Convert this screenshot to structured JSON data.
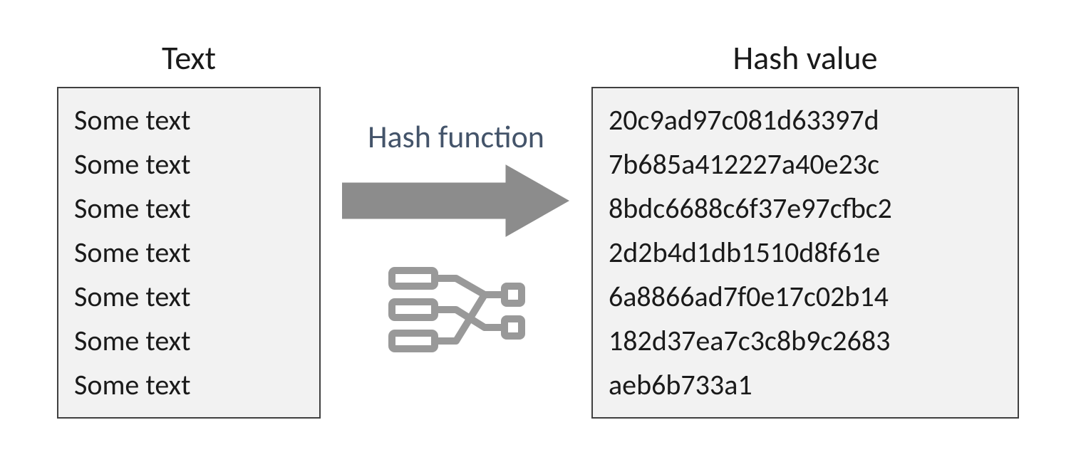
{
  "left": {
    "heading": "Text",
    "lines": [
      "Some text",
      "Some text",
      "Some text",
      "Some text",
      "Some text",
      "Some text",
      "Some text"
    ]
  },
  "middle": {
    "label": "Hash function"
  },
  "right": {
    "heading": "Hash value",
    "lines": [
      "20c9ad97c081d63397d",
      "7b685a412227a40e23c",
      "8bdc6688c6f37e97cfbc2",
      "2d2b4d1db1510d8f61e",
      "6a8866ad7f0e17c02b14",
      "182d37ea7c3c8b9c2683",
      "aeb6b733a1"
    ]
  },
  "colors": {
    "box_border": "#404040",
    "box_bg": "#f2f2f2",
    "text": "#1a1a1a",
    "label": "#44546a",
    "arrow": "#8c8c8c",
    "icon": "#999999"
  }
}
